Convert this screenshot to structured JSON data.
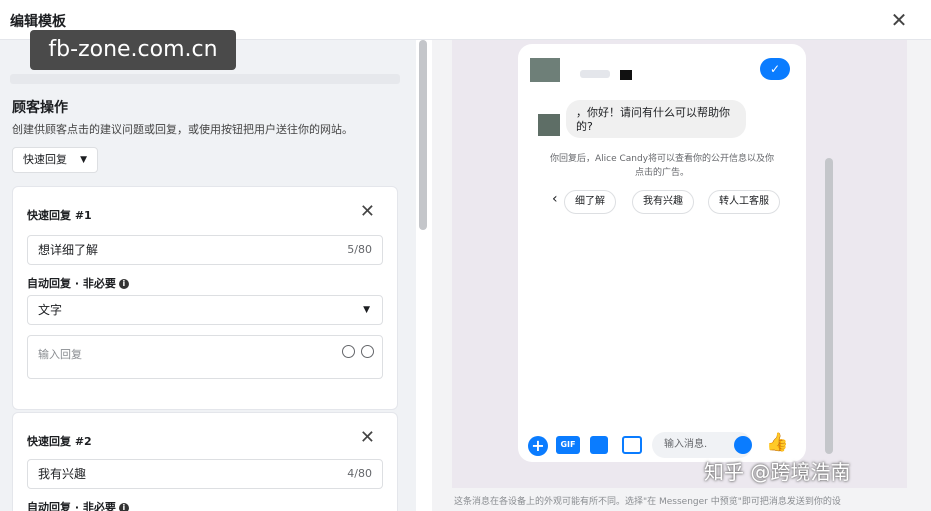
{
  "header": {
    "title": "编辑模板",
    "close_icon": "close-icon"
  },
  "watermark_top": "fb-zone.com.cn",
  "watermark_bottom": "知乎 @跨境浩南",
  "left_panel": {
    "section_title": "顾客操作",
    "section_desc": "创建供顾客点击的建议问题或回复，或使用按钮把用户送往你的网站。",
    "type_dropdown": "快速回复",
    "cards": [
      {
        "title": "快速回复 #1",
        "value": "想详细了解",
        "count": "5/80",
        "auto_reply_label": "自动回复 · 非必要",
        "select_value": "文字",
        "reply_placeholder": "输入回复"
      },
      {
        "title": "快速回复 #2",
        "value": "我有兴趣",
        "count": "4/80",
        "auto_reply_label": "自动回复 · 非必要"
      }
    ]
  },
  "preview": {
    "greeting": "，你好！请问有什么可以帮助你的?",
    "info": "你回复后，Alice Candy将可以查看你的公开信息以及你点击的广告。",
    "chips": [
      "细了解",
      "我有兴趣",
      "转人工客服"
    ],
    "composer_placeholder": "输入消息.",
    "gif_label": "GIF",
    "footer_note": "这条消息在各设备上的外观可能有所不同。选择\"在 Messenger 中预览\"即可把消息发送到你的设"
  },
  "colors": {
    "accent": "#0a7cff",
    "panel_bg": "#f0f2f5",
    "preview_bg": "#ece8ef"
  }
}
